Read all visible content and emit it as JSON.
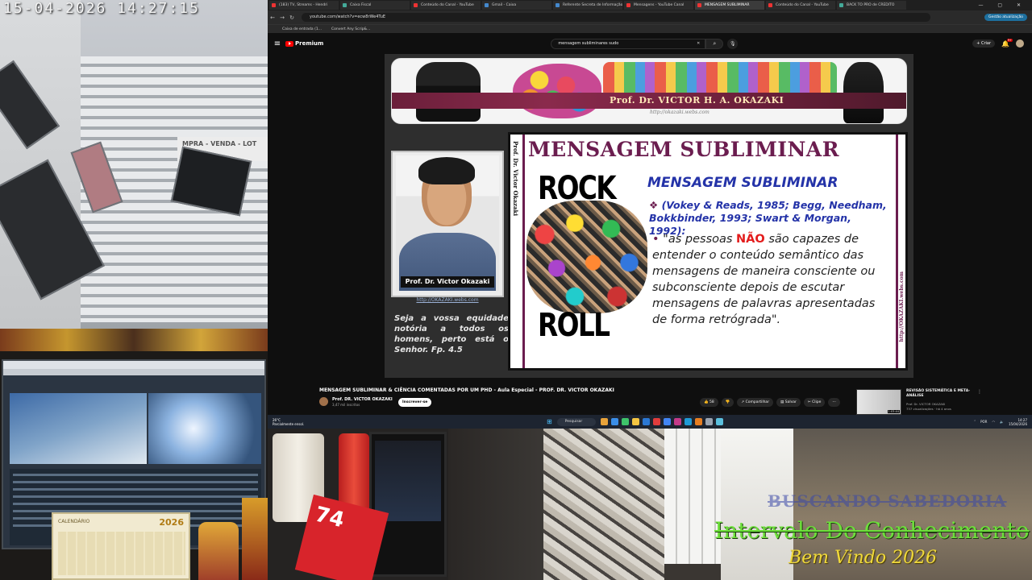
{
  "cameras": {
    "top_left": {
      "timestamp": "15-04-2026  14:27:15",
      "sign_text": "MPRA - VENDA - LOT"
    },
    "bottom_left": {
      "calendar_year": "2026",
      "calendar_title": "CALENDÁRIO"
    },
    "bottom_mid": {
      "box_text": "74"
    },
    "bottom_right": {
      "overlay_line1": "BUSCANDO SABEDORIA",
      "overlay_line2": "Intervalo Do Conhecimento",
      "overlay_line3": "Bem Vindo 2026"
    }
  },
  "browser": {
    "tabs": [
      {
        "label": "(183) TV, Streams - Hendri"
      },
      {
        "label": "Caixa Fiscal"
      },
      {
        "label": "Conteúdo do Canal - YouTube"
      },
      {
        "label": "Gmail - Caixa"
      },
      {
        "label": "Referente Secreta de Informação"
      },
      {
        "label": "Mensagens - YouTube Canal"
      },
      {
        "label": "MENSAGEM SUBLIMINAR"
      },
      {
        "label": "Conteúdo do Canal - YouTube"
      },
      {
        "label": "BACK TO PRO de CREDITO"
      }
    ],
    "window_controls": "— ▢ ✕",
    "url": "youtube.com/watch?v=ecw8rWe4TuE",
    "gestao_label": "Gestão atualização",
    "bookmarks": [
      "Caixa de entrada (1...",
      "Convert Any Scrip&..."
    ]
  },
  "youtube": {
    "brand": "Premium",
    "search_value": "mensagem subliminares sudo",
    "search_clear": "✕",
    "create_label": "+ Criar",
    "notif_count": "9+",
    "video_title": "MENSAGEM SUBLIMINAR & CIÊNCIA COMENTADAS POR UM PHD - Aula Especial - PROF. DR. VICTOR OKAZAKI",
    "channel_name": "Prof. DR. VICTOR OKAZAKI",
    "subscribers": "3,47 mil inscritos",
    "subscribe_label": "Inscrever-se",
    "actions": [
      {
        "label": "👍 58"
      },
      {
        "label": "👎"
      },
      {
        "label": "↗ Compartilhar"
      },
      {
        "label": "▤ Salvar"
      },
      {
        "label": "✂ Clipe"
      },
      {
        "label": "⋯"
      }
    ],
    "recommended": {
      "title": "REVISÃO SISTEMÁTICA E META-ANÁLISE",
      "channel": "Prof. Dr. VICTOR OKAZAKI",
      "views": "737 visualizações · há 4 anos",
      "duration": "1:03:44",
      "more": "⋮"
    }
  },
  "video": {
    "banner_name": "Prof. Dr. VICTOR H. A. OKAZAKI",
    "banner_site": "http://okazaki.webs.com",
    "photo_name": "Prof. Dr. Victor Okazaki",
    "photo_site": "http://OKAZAKI.webs.com",
    "verse": "Seja a vossa equidade notória a todos os homens, perto está o Senhor. Fp. 4.5",
    "side_left": "Prof. Dr. Victor Okazaki",
    "side_right": "http://OKAZAKI.webs.com",
    "slide_title": "MENSAGEM SUBLIMINAR",
    "rock_top": "ROCK",
    "rock_bottom": "ROLL",
    "subtitle": "MENSAGEM SUBLIMINAR",
    "citation_bullet": "❖",
    "citation": "(Vokey & Reads, 1985; Begg, Needham, Bokkbinder, 1993; Swart & Morgan, 1992):",
    "quote_bullet": "•",
    "quote_pre": "\"as pessoas ",
    "quote_nao": "NÃO",
    "quote_post": " são capazes de entender o conteúdo semântico das mensagens de maneira consciente ou subconsciente depois de escutar mensagens de palavras apresentadas de forma retrógrada\"."
  },
  "taskbar": {
    "weather_temp": "26°C",
    "weather_desc": "Parcialmente ensol.",
    "search_label": "Pesquisar",
    "lang": "POR",
    "time": "14:27",
    "date": "15/04/2026"
  },
  "colors": {
    "youtube_red": "#ff0000",
    "slide_maroon": "#6b1d4f",
    "slide_blue": "#2433a8",
    "nao_red": "#e31c1c",
    "overlay_green": "#6ddf3b",
    "overlay_yellow": "#f0d93b"
  }
}
